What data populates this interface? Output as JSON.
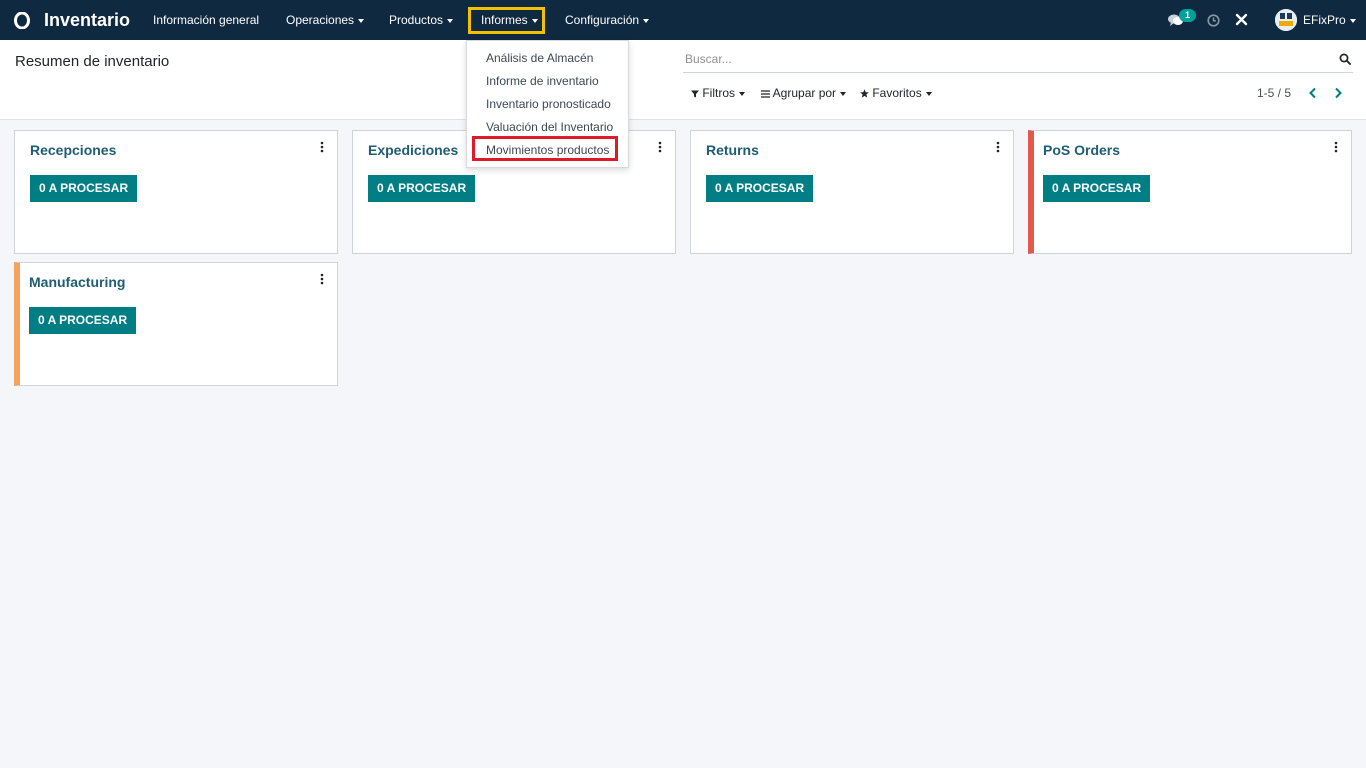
{
  "navbar": {
    "app_title": "Inventario",
    "menu": {
      "general": "Información general",
      "operations": "Operaciones",
      "products": "Productos",
      "reports": "Informes",
      "config": "Configuración"
    },
    "chat_count": "1",
    "user_name": "EFixPro",
    "colors": {
      "background": "#0f2940",
      "badge": "#00a09d",
      "highlight_yellow": "#f2c200"
    }
  },
  "control_panel": {
    "title": "Resumen de inventario",
    "search_placeholder": "Buscar...",
    "filters_label": "Filtros",
    "groupby_label": "Agrupar por",
    "favorites_label": "Favoritos",
    "pager": "1-5 / 5"
  },
  "reports_dropdown": {
    "items": [
      "Análisis de Almacén",
      "Informe de inventario",
      "Inventario pronosticado",
      "Valuación del Inventario",
      "Movimientos productos"
    ],
    "highlight_color": "#e0192a"
  },
  "cards": [
    {
      "title": "Recepciones",
      "button": "0 A PROCESAR"
    },
    {
      "title": "Expediciones",
      "button": "0 A PROCESAR"
    },
    {
      "title": "Returns",
      "button": "0 A PROCESAR"
    },
    {
      "title": "PoS Orders",
      "button": "0 A PROCESAR",
      "accent": "#e2584d"
    },
    {
      "title": "Manufacturing",
      "button": "0 A PROCESAR",
      "accent": "#f4a460"
    }
  ],
  "button_color": "#017e84"
}
